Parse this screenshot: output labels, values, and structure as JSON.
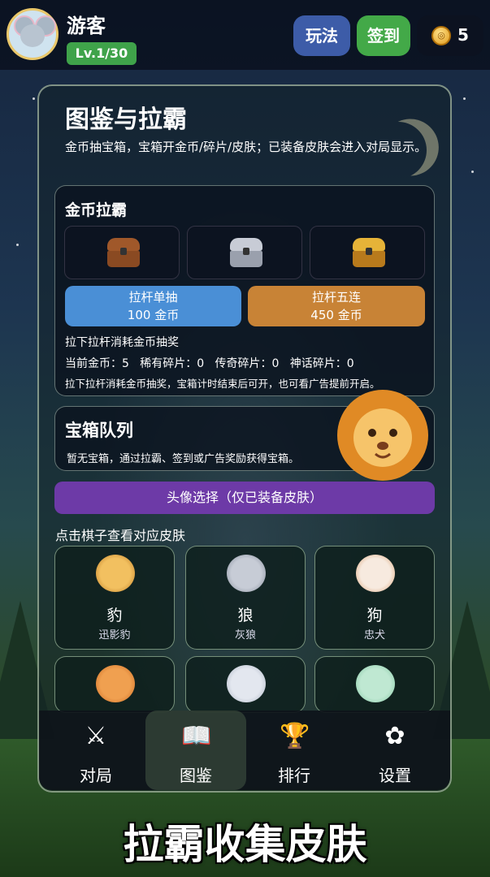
{
  "header": {
    "username": "游客",
    "level": "Lv.1/30",
    "help_label": "玩法",
    "sign_label": "签到",
    "coins": "5"
  },
  "panel": {
    "title": "图鉴与拉霸",
    "description": "金币抽宝箱，宝箱开金币/碎片/皮肤；已装备皮肤会进入对局显示。"
  },
  "slot": {
    "title": "金币拉霸",
    "chests": [
      "wooden-chest-icon",
      "silver-chest-icon",
      "golden-chest-icon"
    ],
    "single": {
      "label": "拉杆单抽",
      "cost": "100 金币"
    },
    "five": {
      "label": "拉杆五连",
      "cost": "450 金币"
    },
    "hint": "拉下拉杆消耗金币抽奖",
    "stats": "当前金币：5   稀有碎片：0   传奇碎片：0   神话碎片：0",
    "note": "拉下拉杆消耗金币抽奖，宝箱计时结束后可开，也可看广告提前开启。"
  },
  "queue": {
    "title": "宝箱队列",
    "empty": "暂无宝箱，通过拉霸、签到或广告奖励获得宝箱。"
  },
  "avatar_select": "头像选择（仅已装备皮肤）",
  "grid_label": "点击棋子查看对应皮肤",
  "cards": [
    {
      "name": "豹",
      "sub": "迅影豹",
      "icon": "leopard-icon"
    },
    {
      "name": "狼",
      "sub": "灰狼",
      "icon": "wolf-icon"
    },
    {
      "name": "狗",
      "sub": "忠犬",
      "icon": "dog-icon"
    },
    {
      "name": "",
      "sub": "",
      "icon": "cat-icon"
    },
    {
      "name": "",
      "sub": "",
      "icon": "mouse-icon"
    },
    {
      "name": "",
      "sub": "",
      "icon": "rabbit-icon"
    }
  ],
  "nav": [
    {
      "label": "对局",
      "icon": "swords-icon"
    },
    {
      "label": "图鉴",
      "icon": "book-icon"
    },
    {
      "label": "排行",
      "icon": "trophy-icon"
    },
    {
      "label": "设置",
      "icon": "settings-icon"
    }
  ],
  "banner": "拉霸收集皮肤",
  "colors": {
    "help_button": "#3d5ca8",
    "sign_button": "#43a948",
    "single_pull": "#4a8fd6",
    "five_pull": "#c88336",
    "avatar_select": "#6d3aa7"
  }
}
